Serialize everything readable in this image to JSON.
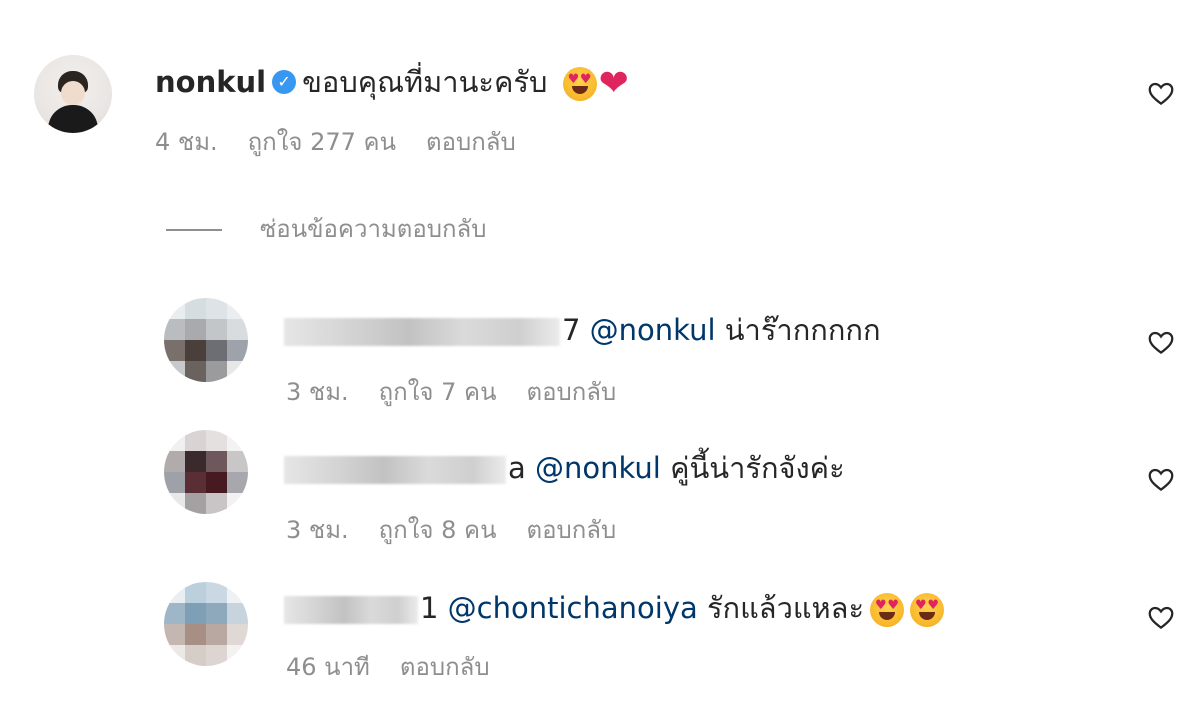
{
  "main_comment": {
    "username": "nonkul",
    "text": "ขอบคุณที่มานะครับ",
    "emojis": [
      "smiling-face-with-heart-eyes-emoji",
      "red-heart-emoji"
    ],
    "time": "4 ชม.",
    "likes": "ถูกใจ 277 คน",
    "reply_label": "ตอบกลับ"
  },
  "hide_replies_label": "ซ่อนข้อความตอบกลับ",
  "replies": [
    {
      "username_visible": "7",
      "mention": "@nonkul",
      "text": "น่าร๊ากกกกก",
      "time": "3 ชม.",
      "likes": "ถูกใจ 7 คน",
      "reply_label": "ตอบกลับ",
      "avatar_colors": [
        "#e8edef",
        "#d6dde0",
        "#dde3e6",
        "#ebeef0",
        "#b9bdc0",
        "#a8aaac",
        "#c3c6c9",
        "#d9dcde",
        "#7a706b",
        "#4a3f3a",
        "#6c6e73",
        "#9ea3ab",
        "#c7c9cb",
        "#6a625e",
        "#9b9a9c",
        "#e6e7e8"
      ]
    },
    {
      "username_visible": "a",
      "mention": "@nonkul",
      "text": "คู่นี้น่ารักจังค่ะ",
      "time": "3 ชม.",
      "likes": "ถูกใจ 8 คน",
      "reply_label": "ตอบกลับ",
      "avatar_colors": [
        "#f0f0f0",
        "#d9d4d3",
        "#e4e0df",
        "#f3f3f3",
        "#b1acab",
        "#3b2a2c",
        "#6e585b",
        "#c8c6c7",
        "#9ea1a8",
        "#5a2e35",
        "#471a22",
        "#a7a8ad",
        "#e8e8e9",
        "#a4a1a2",
        "#c9c5c6",
        "#f2f2f2"
      ]
    },
    {
      "username_visible": "1",
      "mention": "@chontichanoiya",
      "text": "รักแล้วแหละ",
      "time": "46 นาที",
      "likes": "",
      "reply_label": "ตอบกลับ",
      "avatar_colors": [
        "#e9eef2",
        "#bccfdd",
        "#c9d8e3",
        "#eef2f5",
        "#9fb6c8",
        "#7f9fb7",
        "#8fa9bc",
        "#c7d4de",
        "#c4b6b0",
        "#a88f86",
        "#b9a8a2",
        "#dfd8d5",
        "#ece8e6",
        "#d6ccc8",
        "#ddd5d2",
        "#f4f2f1"
      ]
    }
  ]
}
